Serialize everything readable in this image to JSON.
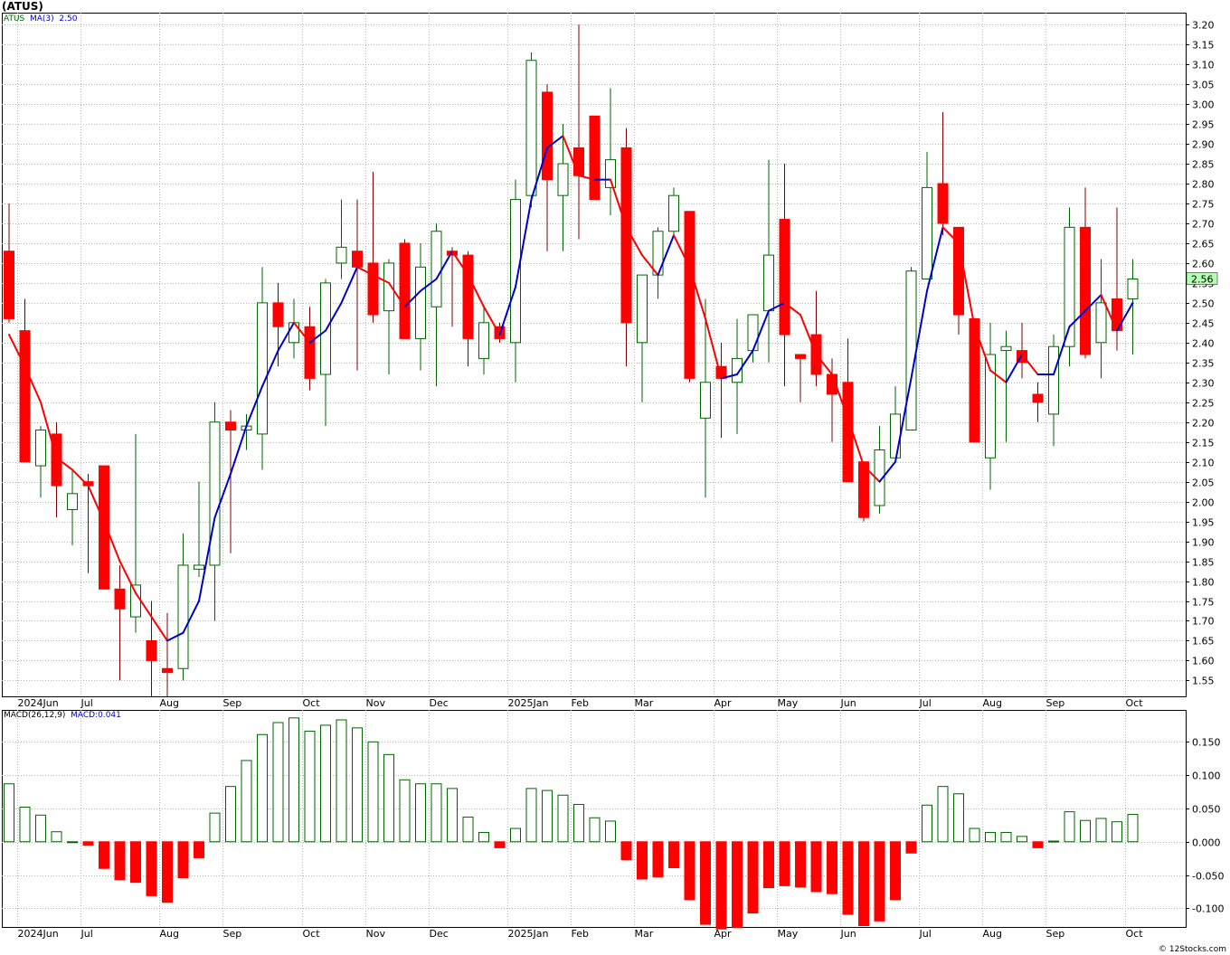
{
  "header": {
    "symbol": "(ATUS)",
    "ticker": "ATUS",
    "ma_label": "MA(3)",
    "ma_value": "2.50",
    "macd_label": "MACD(26,12,9)",
    "macd_value": "MACD:0.041",
    "credit": "© 12Stocks.com",
    "last_price": "2.56"
  },
  "colors": {
    "up_border": "#006400",
    "down_fill": "#ff0000",
    "ma_up": "#0000cc",
    "ma_down": "#ff0000",
    "grid": "#b4b4b4",
    "last_price_bg": "#b4ffb4"
  },
  "chart_data": [
    {
      "type": "candlestick",
      "title": "(ATUS)",
      "ylim": [
        1.51,
        3.23
      ],
      "y_ticks": [
        "3.20",
        "3.15",
        "3.10",
        "3.05",
        "3.00",
        "2.95",
        "2.90",
        "2.85",
        "2.80",
        "2.75",
        "2.70",
        "2.65",
        "2.60",
        "2.55",
        "2.50",
        "2.45",
        "2.40",
        "2.35",
        "2.30",
        "2.25",
        "2.20",
        "2.15",
        "2.10",
        "2.05",
        "2.00",
        "1.95",
        "1.90",
        "1.85",
        "1.80",
        "1.75",
        "1.70",
        "1.65",
        "1.60",
        "1.55"
      ],
      "x_labels": [
        {
          "label": "2024Jun",
          "index": 0.5
        },
        {
          "label": "Jul",
          "index": 4.5
        },
        {
          "label": "Aug",
          "index": 9.5
        },
        {
          "label": "Sep",
          "index": 13.5
        },
        {
          "label": "Oct",
          "index": 18.5
        },
        {
          "label": "Nov",
          "index": 22.5
        },
        {
          "label": "Dec",
          "index": 26.5
        },
        {
          "label": "2025Jan",
          "index": 31.5
        },
        {
          "label": "Feb",
          "index": 35.5
        },
        {
          "label": "Mar",
          "index": 39.5
        },
        {
          "label": "Apr",
          "index": 44.5
        },
        {
          "label": "May",
          "index": 48.5
        },
        {
          "label": "Jun",
          "index": 52.5
        },
        {
          "label": "Jul",
          "index": 57.5
        },
        {
          "label": "Aug",
          "index": 61.5
        },
        {
          "label": "Sep",
          "index": 65.5
        },
        {
          "label": "Oct",
          "index": 70.5
        }
      ],
      "candles": [
        [
          2.63,
          2.75,
          2.45,
          2.46
        ],
        [
          2.43,
          2.51,
          2.1,
          2.1
        ],
        [
          2.09,
          2.19,
          2.01,
          2.18
        ],
        [
          2.17,
          2.2,
          1.96,
          2.04
        ],
        [
          1.98,
          2.08,
          1.89,
          2.02
        ],
        [
          2.05,
          2.07,
          1.82,
          2.04
        ],
        [
          2.09,
          2.09,
          1.78,
          1.78
        ],
        [
          1.78,
          1.84,
          1.55,
          1.73
        ],
        [
          1.71,
          2.17,
          1.67,
          1.79
        ],
        [
          1.65,
          1.75,
          1.51,
          1.6
        ],
        [
          1.58,
          1.72,
          1.51,
          1.57
        ],
        [
          1.58,
          1.92,
          1.55,
          1.84
        ],
        [
          1.83,
          2.05,
          1.81,
          1.84
        ],
        [
          1.84,
          2.25,
          1.7,
          2.2
        ],
        [
          2.2,
          2.23,
          1.87,
          2.18
        ],
        [
          2.18,
          2.22,
          2.13,
          2.19
        ],
        [
          2.17,
          2.59,
          2.08,
          2.5
        ],
        [
          2.5,
          2.55,
          2.34,
          2.44
        ],
        [
          2.4,
          2.51,
          2.36,
          2.45
        ],
        [
          2.44,
          2.49,
          2.28,
          2.31
        ],
        [
          2.32,
          2.56,
          2.19,
          2.55
        ],
        [
          2.6,
          2.76,
          2.56,
          2.64
        ],
        [
          2.63,
          2.76,
          2.33,
          2.59
        ],
        [
          2.6,
          2.83,
          2.45,
          2.47
        ],
        [
          2.48,
          2.61,
          2.32,
          2.6
        ],
        [
          2.65,
          2.66,
          2.41,
          2.41
        ],
        [
          2.41,
          2.65,
          2.33,
          2.59
        ],
        [
          2.49,
          2.7,
          2.29,
          2.68
        ],
        [
          2.63,
          2.64,
          2.44,
          2.62
        ],
        [
          2.62,
          2.63,
          2.34,
          2.41
        ],
        [
          2.36,
          2.49,
          2.32,
          2.45
        ],
        [
          2.44,
          2.45,
          2.4,
          2.41
        ],
        [
          2.4,
          2.81,
          2.3,
          2.76
        ],
        [
          2.77,
          3.13,
          2.74,
          3.11
        ],
        [
          3.03,
          3.05,
          2.63,
          2.81
        ],
        [
          2.77,
          2.95,
          2.63,
          2.85
        ],
        [
          2.89,
          3.2,
          2.66,
          2.82
        ],
        [
          2.97,
          2.97,
          2.76,
          2.76
        ],
        [
          2.79,
          3.04,
          2.72,
          2.86
        ],
        [
          2.89,
          2.94,
          2.34,
          2.45
        ],
        [
          2.4,
          2.55,
          2.25,
          2.57
        ],
        [
          2.57,
          2.69,
          2.51,
          2.68
        ],
        [
          2.68,
          2.79,
          2.67,
          2.77
        ],
        [
          2.73,
          2.73,
          2.3,
          2.31
        ],
        [
          2.21,
          2.51,
          2.01,
          2.3
        ],
        [
          2.34,
          2.4,
          2.16,
          2.31
        ],
        [
          2.3,
          2.46,
          2.17,
          2.36
        ],
        [
          2.38,
          2.46,
          2.35,
          2.47
        ],
        [
          2.48,
          2.86,
          2.35,
          2.62
        ],
        [
          2.71,
          2.85,
          2.29,
          2.42
        ],
        [
          2.37,
          2.37,
          2.25,
          2.36
        ],
        [
          2.42,
          2.53,
          2.29,
          2.32
        ],
        [
          2.32,
          2.36,
          2.15,
          2.27
        ],
        [
          2.3,
          2.41,
          2.05,
          2.05
        ],
        [
          2.1,
          2.1,
          1.95,
          1.96
        ],
        [
          1.99,
          2.19,
          1.97,
          2.13
        ],
        [
          2.11,
          2.29,
          2.11,
          2.22
        ],
        [
          2.18,
          2.59,
          2.18,
          2.58
        ],
        [
          2.56,
          2.88,
          2.56,
          2.79
        ],
        [
          2.8,
          2.98,
          2.67,
          2.7
        ],
        [
          2.69,
          2.69,
          2.42,
          2.47
        ],
        [
          2.46,
          2.46,
          2.15,
          2.15
        ],
        [
          2.11,
          2.45,
          2.03,
          2.37
        ],
        [
          2.38,
          2.43,
          2.15,
          2.39
        ],
        [
          2.38,
          2.45,
          2.31,
          2.35
        ],
        [
          2.27,
          2.3,
          2.2,
          2.25
        ],
        [
          2.22,
          2.42,
          2.14,
          2.39
        ],
        [
          2.39,
          2.74,
          2.34,
          2.69
        ],
        [
          2.69,
          2.79,
          2.36,
          2.37
        ],
        [
          2.4,
          2.61,
          2.31,
          2.5
        ],
        [
          2.51,
          2.74,
          2.38,
          2.43
        ],
        [
          2.51,
          2.61,
          2.37,
          2.56
        ]
      ],
      "ma3": [
        2.42,
        2.34,
        2.25,
        2.11,
        2.08,
        2.04,
        1.95,
        1.85,
        1.77,
        1.71,
        1.65,
        1.67,
        1.75,
        1.96,
        2.07,
        2.19,
        2.29,
        2.38,
        2.45,
        2.4,
        2.43,
        2.5,
        2.59,
        2.57,
        2.55,
        2.49,
        2.53,
        2.56,
        2.63,
        2.57,
        2.49,
        2.42,
        2.54,
        2.76,
        2.89,
        2.92,
        2.82,
        2.81,
        2.81,
        2.69,
        2.62,
        2.57,
        2.67,
        2.59,
        2.46,
        2.31,
        2.32,
        2.38,
        2.48,
        2.5,
        2.47,
        2.37,
        2.32,
        2.21,
        2.09,
        2.05,
        2.1,
        2.31,
        2.53,
        2.69,
        2.65,
        2.44,
        2.33,
        2.3,
        2.37,
        2.32,
        2.32,
        2.44,
        2.48,
        2.52,
        2.43,
        2.5
      ]
    },
    {
      "type": "bar",
      "title": "MACD(26,12,9)",
      "ylim": [
        -0.128,
        0.198
      ],
      "y_ticks": [
        "0.150",
        "0.100",
        "0.050",
        "0.000",
        "-0.050",
        "-0.100"
      ],
      "values": [
        0.087,
        0.052,
        0.04,
        0.015,
        0.0,
        -0.005,
        -0.04,
        -0.057,
        -0.061,
        -0.081,
        -0.091,
        -0.054,
        -0.024,
        0.043,
        0.083,
        0.122,
        0.161,
        0.179,
        0.186,
        0.166,
        0.175,
        0.183,
        0.171,
        0.15,
        0.131,
        0.093,
        0.087,
        0.087,
        0.08,
        0.037,
        0.014,
        -0.009,
        0.02,
        0.08,
        0.077,
        0.07,
        0.056,
        0.036,
        0.031,
        -0.027,
        -0.056,
        -0.053,
        -0.039,
        -0.087,
        -0.124,
        -0.131,
        -0.129,
        -0.107,
        -0.069,
        -0.066,
        -0.068,
        -0.075,
        -0.078,
        -0.109,
        -0.126,
        -0.119,
        -0.087,
        -0.017,
        0.055,
        0.083,
        0.072,
        0.02,
        0.014,
        0.014,
        0.008,
        -0.009,
        0.001,
        0.045,
        0.032,
        0.035,
        0.03,
        0.041
      ]
    }
  ]
}
